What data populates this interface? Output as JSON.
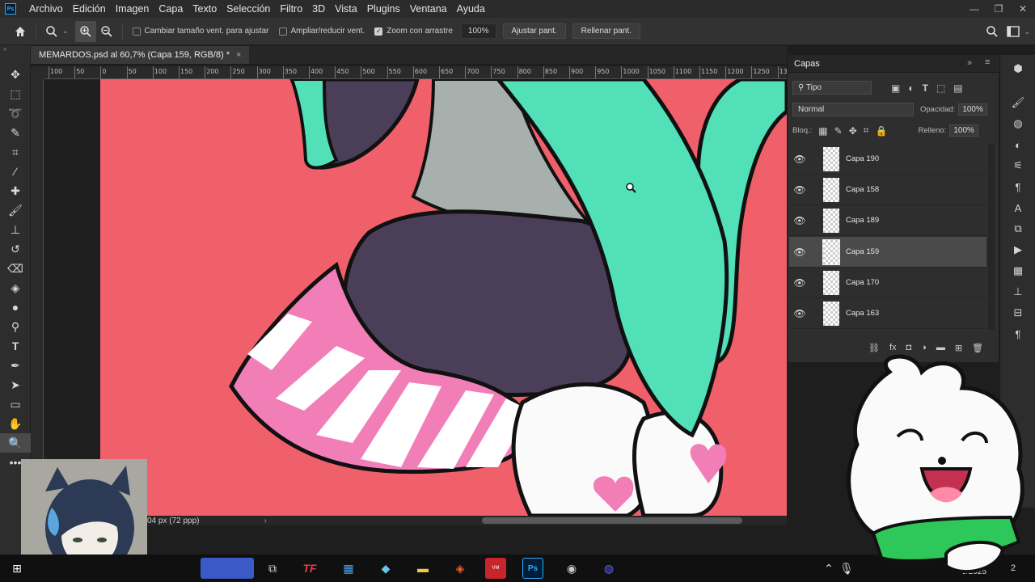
{
  "app": {
    "logo": "Ps"
  },
  "menu": [
    "Archivo",
    "Edición",
    "Imagen",
    "Capa",
    "Texto",
    "Selección",
    "Filtro",
    "3D",
    "Vista",
    "Plugins",
    "Ventana",
    "Ayuda"
  ],
  "options": {
    "resize_windows": "Cambiar tamaño vent. para ajustar",
    "zoom_all": "Ampliar/reducir vent.",
    "scrubby_zoom": "Zoom con arrastre",
    "zoom_value": "100%",
    "fit_screen": "Ajustar pant.",
    "fill_screen": "Rellenar pant."
  },
  "document": {
    "tab_title": "MEMARDOS.psd al 60,7% (Capa 159, RGB/8) *",
    "close": "×"
  },
  "ruler_labels": [
    "100",
    "50",
    "0",
    "50",
    "100",
    "150",
    "200",
    "250",
    "300",
    "350",
    "400",
    "450",
    "500",
    "550",
    "600",
    "650",
    "700",
    "750",
    "800",
    "850",
    "900",
    "950",
    "1000",
    "1050",
    "1100",
    "1150",
    "1200",
    "1250",
    "1300"
  ],
  "status": {
    "info": "04 px (72 ppp)",
    "arrow": "›"
  },
  "layers_panel": {
    "title": "Capas",
    "filter_kind": "Tipo",
    "blend_mode": "Normal",
    "opacity_label": "Opacidad:",
    "opacity_value": "100%",
    "lock_label": "Bloq.:",
    "fill_label": "Relleno:",
    "fill_value": "100%",
    "layers": [
      {
        "name": "Capa 190",
        "selected": false
      },
      {
        "name": "Capa 158",
        "selected": false
      },
      {
        "name": "Capa 189",
        "selected": false
      },
      {
        "name": "Capa 159",
        "selected": true
      },
      {
        "name": "Capa 170",
        "selected": false
      },
      {
        "name": "Capa 163",
        "selected": false
      }
    ]
  },
  "taskbar": {
    "date_fragment": "J/2025",
    "notification_count": "2"
  },
  "colors": {
    "canvas_bg": "#f0606a",
    "hair": "#52e0b8",
    "shorts": "#4b3e58",
    "stripe_pink": "#f27eb8",
    "accent": "#31a8ff"
  }
}
